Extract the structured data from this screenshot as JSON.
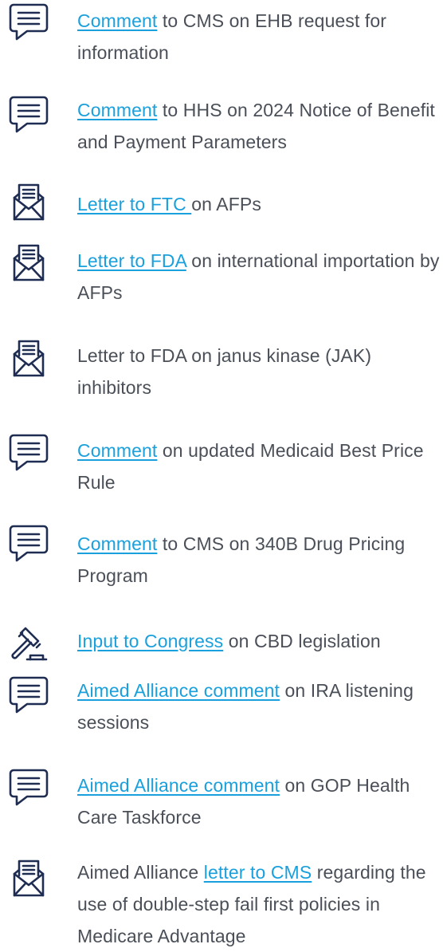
{
  "colors": {
    "text": "#4a4f58",
    "link": "#1aa0dc",
    "icon": "#1f2d52"
  },
  "items": [
    {
      "icon": "comment-icon",
      "parts": [
        {
          "text": "Comment",
          "link": true
        },
        {
          "text": " to CMS on EHB request for information",
          "link": false
        }
      ]
    },
    {
      "icon": "comment-icon",
      "parts": [
        {
          "text": "Comment",
          "link": true
        },
        {
          "text": " to HHS on 2024 Notice of Benefit and Payment Parameters",
          "link": false
        }
      ]
    },
    {
      "icon": "letter-icon",
      "parts": [
        {
          "text": "Letter to FTC ",
          "link": true
        },
        {
          "text": "on AFPs",
          "link": false
        }
      ]
    },
    {
      "icon": "letter-icon",
      "parts": [
        {
          "text": "Letter to FDA",
          "link": true
        },
        {
          "text": " on international importation by AFPs",
          "link": false
        }
      ]
    },
    {
      "icon": "letter-icon",
      "parts": [
        {
          "text": "Letter to FDA on janus kinase (JAK) inhibitors",
          "link": false
        }
      ]
    },
    {
      "icon": "comment-icon",
      "parts": [
        {
          "text": "Comment",
          "link": true
        },
        {
          "text": " on updated Medicaid Best Price Rule",
          "link": false
        }
      ]
    },
    {
      "icon": "comment-icon",
      "parts": [
        {
          "text": "Comment",
          "link": true
        },
        {
          "text": " to CMS on 340B Drug Pricing Program",
          "link": false
        }
      ]
    },
    {
      "icon": "gavel-icon",
      "parts": [
        {
          "text": "Input to Congress",
          "link": true
        },
        {
          "text": " on CBD legislation",
          "link": false
        }
      ]
    },
    {
      "icon": "comment-icon",
      "parts": [
        {
          "text": "Aimed Alliance comment",
          "link": true
        },
        {
          "text": " on IRA listening sessions",
          "link": false
        }
      ]
    },
    {
      "icon": "comment-icon",
      "parts": [
        {
          "text": "Aimed Alliance comment",
          "link": true
        },
        {
          "text": " on GOP Health Care Taskforce",
          "link": false
        }
      ]
    },
    {
      "icon": "letter-icon",
      "parts": [
        {
          "text": "Aimed Alliance ",
          "link": false
        },
        {
          "text": "letter to CMS",
          "link": true
        },
        {
          "text": " regarding the use of double-step fail first policies in Medicare Advantage",
          "link": false
        }
      ]
    }
  ]
}
